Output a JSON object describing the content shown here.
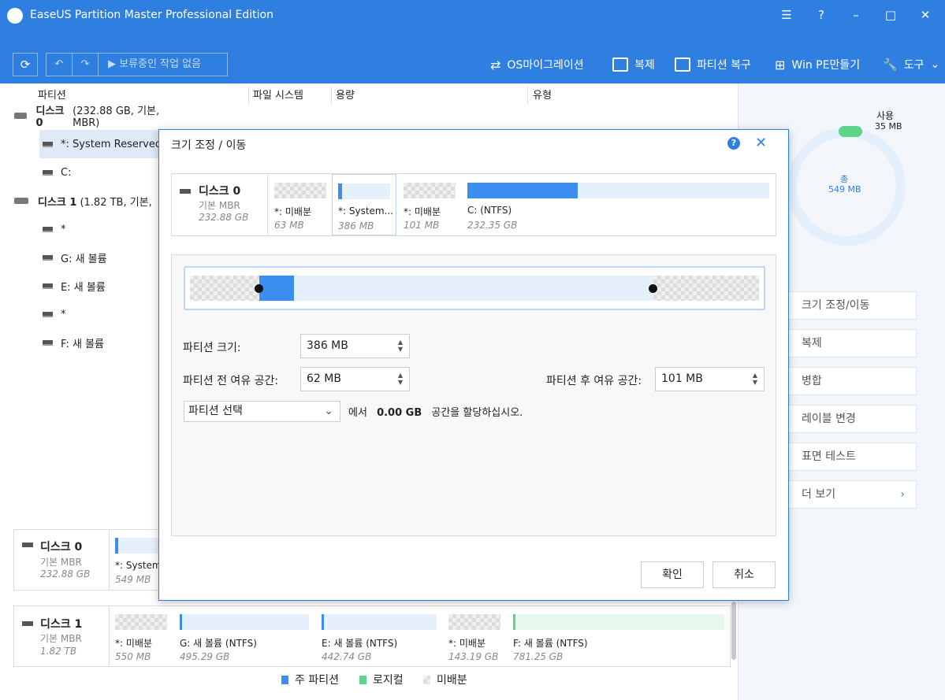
{
  "app": {
    "title": "EaseUS Partition Master Professional Edition"
  },
  "toolbar": {
    "pending": "보류중인 작업 없음",
    "os_migration": "OS마이그레이션",
    "clone": "복제",
    "partition_recovery": "파티션 복구",
    "winpe": "Win PE만들기",
    "tools": "도구"
  },
  "table": {
    "headers": [
      "파티션",
      "파일 시스템",
      "용량",
      "유형"
    ],
    "rows": [
      {
        "type": "disk",
        "name": "디스크 0",
        "info": "(232.88 GB, 기본, MBR)"
      },
      {
        "type": "part",
        "label": "*: System Reserved",
        "selected": true
      },
      {
        "type": "part",
        "label": "C:"
      },
      {
        "type": "disk",
        "name": "디스크 1",
        "info": "(1.82 TB, 기본,"
      },
      {
        "type": "part",
        "label": "*"
      },
      {
        "type": "part",
        "label": "G: 새 볼륨"
      },
      {
        "type": "part",
        "label": "E: 새 볼륨"
      },
      {
        "type": "part",
        "label": "*"
      },
      {
        "type": "part",
        "label": "F: 새 볼륨"
      }
    ]
  },
  "usage": {
    "used_label": "사용",
    "used_value": "35 MB",
    "total_label": "총",
    "total_value": "549 MB"
  },
  "actions": [
    "크기 조정/이동",
    "복제",
    "병합",
    "레이블 변경",
    "표면 테스트",
    "더 보기"
  ],
  "bottom": {
    "disk0": {
      "name": "디스크 0",
      "type": "기본 MBR",
      "size": "232.88 GB",
      "part_name": "*: System",
      "part_size": "549 MB"
    },
    "disk1": {
      "name": "디스크 1",
      "type": "기본 MBR",
      "size": "1.82 TB",
      "parts": [
        {
          "name": "*: 미배분",
          "size": "550 MB"
        },
        {
          "name": "G: 새 볼륨 (NTFS)",
          "size": "495.29 GB"
        },
        {
          "name": "E: 새 볼륨 (NTFS)",
          "size": "442.74 GB"
        },
        {
          "name": "*: 미배분",
          "size": "143.19 GB"
        },
        {
          "name": "F: 새 볼륨 (NTFS)",
          "size": "781.25 GB"
        }
      ]
    },
    "legend": {
      "primary": "주 파티션",
      "logical": "로지컬",
      "unallocated": "미배분"
    }
  },
  "dialog": {
    "title": "크기 조정 / 이동",
    "disk": {
      "name": "디스크 0",
      "type": "기본 MBR",
      "size": "232.88 GB"
    },
    "parts": [
      {
        "name": "*: 미배분",
        "size": "63 MB"
      },
      {
        "name": "*: System...",
        "size": "386 MB"
      },
      {
        "name": "*: 미배분",
        "size": "101 MB"
      },
      {
        "name": "C:  (NTFS)",
        "size": "232.35 GB"
      }
    ],
    "partition_size_label": "파티션 크기:",
    "partition_size": "386 MB",
    "before_label": "파티션 전 여유 공간:",
    "before_value": "62 MB",
    "after_label": "파티션 후 여유 공간:",
    "after_value": "101 MB",
    "select_label": "파티션 선택",
    "alloc_prefix": "에서",
    "alloc_value": "0.00 GB",
    "alloc_suffix": "공간을 할당하십시오.",
    "ok": "확인",
    "cancel": "취소"
  }
}
